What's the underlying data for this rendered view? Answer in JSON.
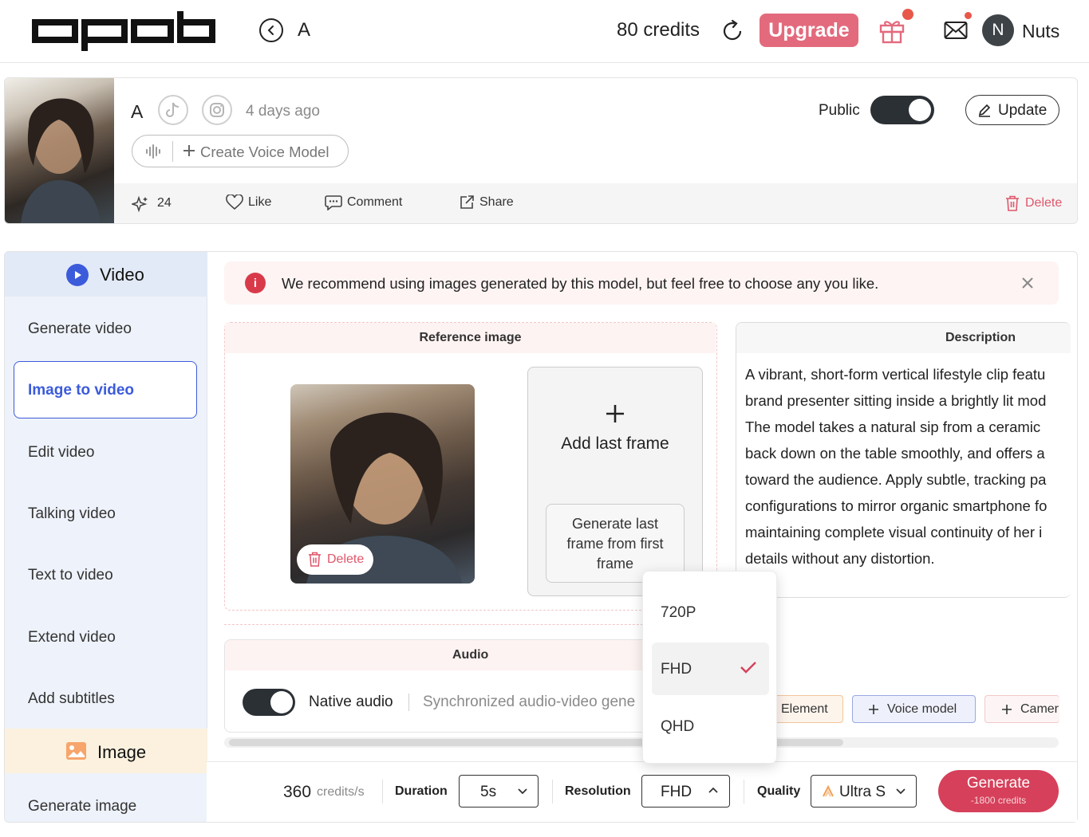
{
  "header": {
    "logo_text": "apob",
    "model_name": "A",
    "credits": "80 credits",
    "upgrade_label": "Upgrade",
    "avatar_initial": "N",
    "username": "Nuts"
  },
  "model_card": {
    "name": "A",
    "time_ago": "4 days ago",
    "create_voice_label": "Create Voice Model",
    "public_label": "Public",
    "public_on": true,
    "update_label": "Update",
    "spark_count": "24",
    "like_label": "Like",
    "comment_label": "Comment",
    "share_label": "Share",
    "delete_label": "Delete"
  },
  "sidebar": {
    "video_section": "Video",
    "items": [
      {
        "label": "Generate video"
      },
      {
        "label": "Image to video",
        "active": true
      },
      {
        "label": "Edit video"
      },
      {
        "label": "Talking video"
      },
      {
        "label": "Text to video"
      },
      {
        "label": "Extend video"
      },
      {
        "label": "Add subtitles"
      }
    ],
    "image_section": "Image",
    "image_items": [
      {
        "label": "Generate image"
      }
    ]
  },
  "notice": {
    "text": "We recommend using images generated by this model, but feel free to choose any you like."
  },
  "reference": {
    "title": "Reference image",
    "delete_label": "Delete",
    "add_last_frame_label": "Add last frame",
    "generate_last_frame_label": "Generate last frame from first frame"
  },
  "description": {
    "title": "Description",
    "lines": [
      "A vibrant, short-form vertical lifestyle clip featu",
      "brand presenter sitting inside a brightly lit mod",
      "The model takes a natural sip from a ceramic",
      "back down on the table smoothly, and offers a",
      "toward the audience. Apply subtle, tracking pa",
      "configurations to mirror organic smartphone fo",
      "maintaining complete visual continuity of her i",
      "details without any distortion."
    ]
  },
  "audio": {
    "title": "Audio",
    "native_audio_label": "Native audio",
    "native_audio_on": true,
    "native_audio_desc": "Synchronized audio-video gene"
  },
  "chips": {
    "element_label": "Element",
    "voice_model_label": "Voice model",
    "camera_label": "Camer"
  },
  "resolution_dropdown": {
    "options": [
      "720P",
      "FHD",
      "QHD"
    ],
    "selected": "FHD"
  },
  "bottom": {
    "credits_rate_value": "360",
    "credits_rate_unit": "credits/s",
    "duration_label": "Duration",
    "duration_value": "5s",
    "resolution_label": "Resolution",
    "resolution_value": "FHD",
    "quality_label": "Quality",
    "quality_value": "Ultra S",
    "generate_label": "Generate",
    "generate_cost": "-1800 credits"
  },
  "colors": {
    "accent_pink": "#e36a7d",
    "generate_red": "#d6405a",
    "active_blue": "#3b5bdb",
    "notice_red": "#d93a4a"
  }
}
